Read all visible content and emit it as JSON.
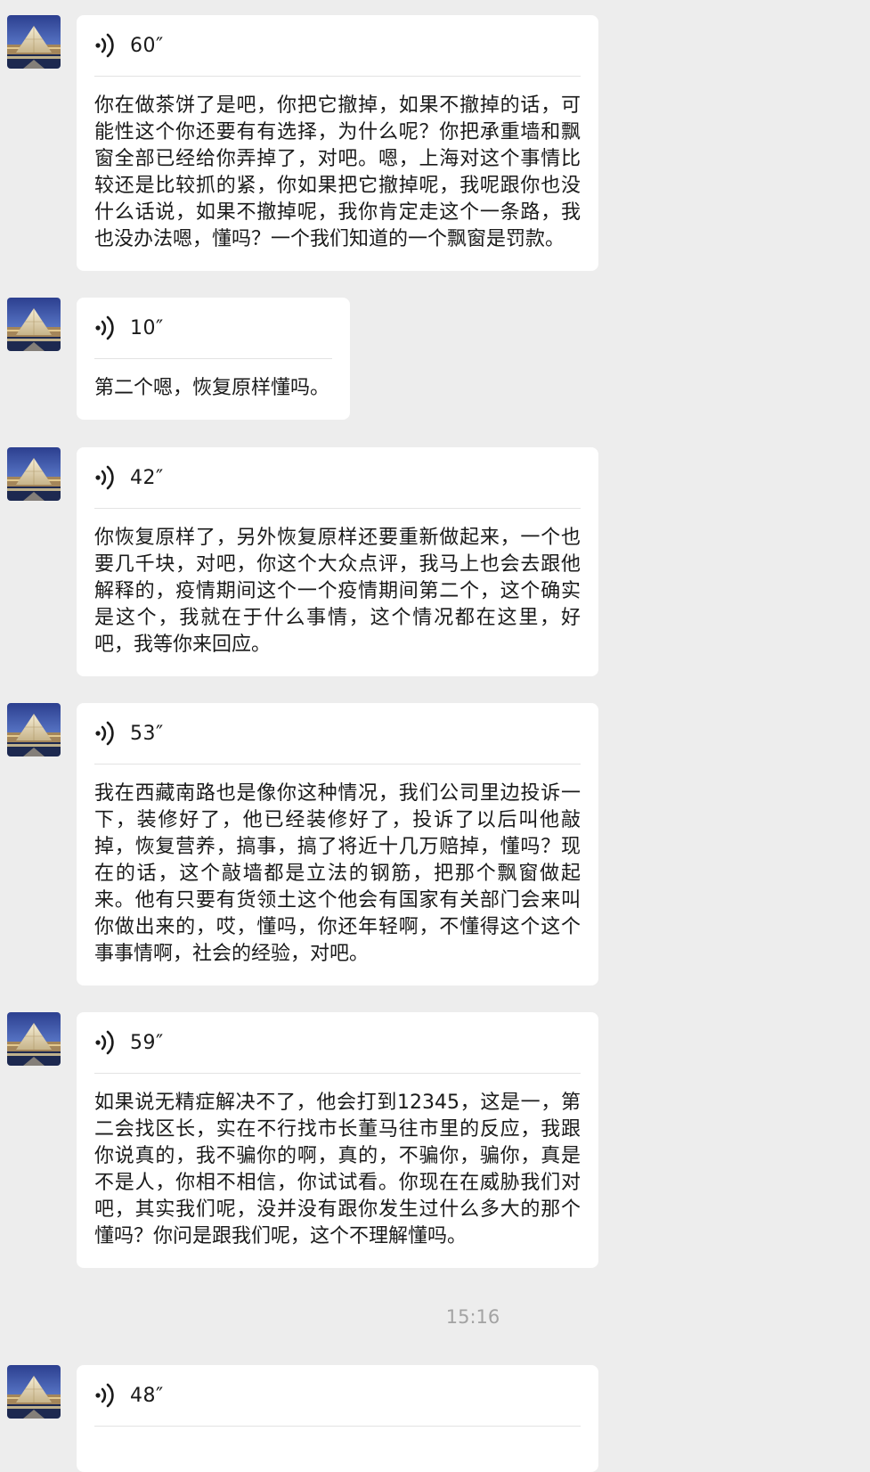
{
  "messages": [
    {
      "duration": "60″",
      "text": "你在做茶饼了是吧，你把它撤掉，如果不撤掉的话，可能性这个你还要有有选择，为什么呢？你把承重墙和飘窗全部已经给你弄掉了，对吧。嗯，上海对这个事情比较还是比较抓的紧，你如果把它撤掉呢，我呢跟你也没什么话说，如果不撤掉呢，我你肯定走这个一条路，我也没办法嗯，懂吗？一个我们知道的一个飘窗是罚款。"
    },
    {
      "duration": "10″",
      "text": "第二个嗯，恢复原样懂吗。"
    },
    {
      "duration": "42″",
      "text": "你恢复原样了，另外恢复原样还要重新做起来，一个也要几千块，对吧，你这个大众点评，我马上也会去跟他解释的，疫情期间这个一个疫情期间第二个，这个确实是这个，我就在于什么事情，这个情况都在这里，好吧，我等你来回应。"
    },
    {
      "duration": "53″",
      "text": "我在西藏南路也是像你这种情况，我们公司里边投诉一下，装修好了，他已经装修好了，投诉了以后叫他敲掉，恢复营养，搞事，搞了将近十几万赔掉，懂吗？现在的话，这个敲墙都是立法的钢筋，把那个飘窗做起来。他有只要有货领土这个他会有国家有关部门会来叫你做出来的，哎，懂吗，你还年轻啊，不懂得这个这个事事情啊，社会的经验，对吧。"
    },
    {
      "duration": "59″",
      "text": "如果说无精症解决不了，他会打到12345，这是一，第二会找区长，实在不行找市长董马往市里的反应，我跟你说真的，我不骗你的啊，真的，不骗你，骗你，真是不是人，你相不相信，你试试看。你现在在威胁我们对吧，其实我们呢，没并没有跟你发生过什么多大的那个懂吗？你问是跟我们呢，这个不理解懂吗。"
    },
    {
      "duration": "48″",
      "text": ""
    }
  ],
  "timestamp": "15:16",
  "icons": {
    "voice": "voice-wave-icon",
    "avatar": "pyramid-night-avatar"
  }
}
